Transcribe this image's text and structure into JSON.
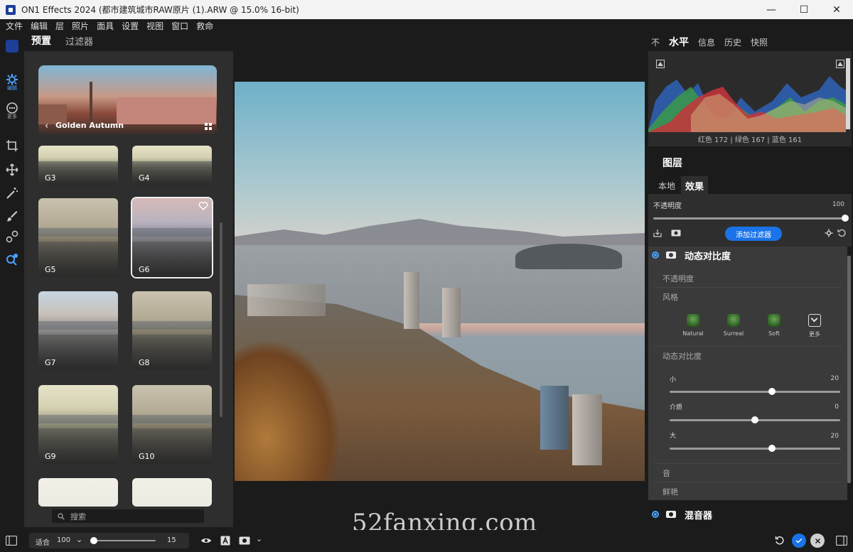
{
  "window": {
    "title": "ON1 Effects 2024 (都市建筑城市RAW原片 (1).ARW @ 15.0% 16-bit)",
    "minimize": "—",
    "maximize": "☐",
    "close": "✕"
  },
  "menu": [
    "文件",
    "编辑",
    "层",
    "照片",
    "面具",
    "设置",
    "视图",
    "窗口",
    "救命"
  ],
  "rail": {
    "edit_label": "编辑",
    "more_label": "更多"
  },
  "left_panel": {
    "tabs": [
      "预置",
      "过滤器"
    ],
    "hero_label": "Golden Autumn",
    "thumbnails": [
      "G3",
      "G4",
      "G5",
      "G6",
      "G7",
      "G8",
      "G9",
      "G10"
    ],
    "selected": "G6",
    "search_placeholder": "搜索"
  },
  "watermark": "52fanxing.com",
  "right_panel": {
    "tabs": [
      "不",
      "水平",
      "信息",
      "历史",
      "快照"
    ],
    "active_tab": "水平",
    "histogram_readout": "红色 172 | 绿色 167 | 蓝色 161",
    "layers_title": "图层",
    "sub_tabs": [
      "本地",
      "效果"
    ],
    "opacity_label": "不透明度",
    "opacity_value": "100",
    "opacity_level": 1.0,
    "add_filter_label": "添加过滤器"
  },
  "effect": {
    "name": "动态对比度",
    "opacity_section": "不透明度",
    "style_section": "风格",
    "styles": [
      "Natural",
      "Surreal",
      "Soft",
      "更多"
    ],
    "dynamic_section": "动态对比度",
    "sliders": [
      {
        "label": "小",
        "value": "20",
        "level": 0.6
      },
      {
        "label": "介质",
        "value": "0",
        "level": 0.5
      },
      {
        "label": "大",
        "value": "20",
        "level": 0.6
      }
    ],
    "tone_section": "音",
    "vibrance_section": "鲜艳"
  },
  "mixer": {
    "name": "混音器"
  },
  "bottom": {
    "fit_label": "适合",
    "zoom_value": "100",
    "zoom_end": "15",
    "zoom_level": 0.03
  },
  "colors": {
    "accent": "#1a73e8",
    "panel": "#2e2e2e",
    "background": "#1b1b1b"
  }
}
